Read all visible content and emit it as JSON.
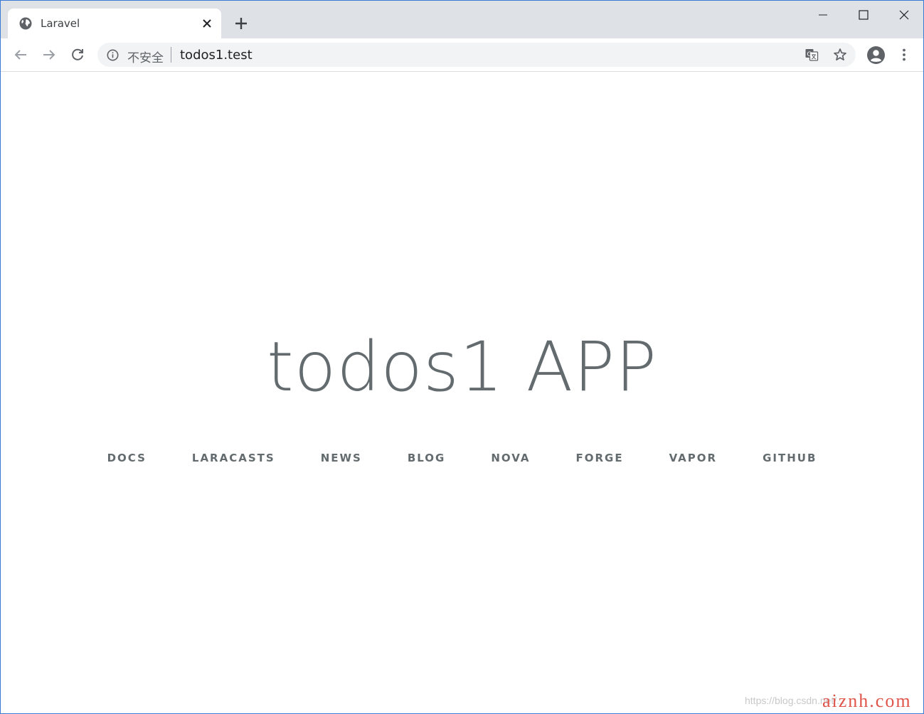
{
  "browser": {
    "tab": {
      "title": "Laravel",
      "favicon": "globe-icon"
    },
    "address_bar": {
      "security_label": "不安全",
      "url": "todos1.test"
    },
    "colors": {
      "tabstrip": "#dee1e6",
      "omnibox": "#f1f3f4",
      "window_border": "#3a7bd5"
    }
  },
  "page": {
    "title": "todos1 APP",
    "links": [
      "DOCS",
      "LARACASTS",
      "NEWS",
      "BLOG",
      "NOVA",
      "FORGE",
      "VAPOR",
      "GITHUB"
    ],
    "text_color": "#636b6f"
  },
  "watermark": {
    "url": "https://blog.csdn.net/...",
    "brand": "aiznh.com"
  }
}
